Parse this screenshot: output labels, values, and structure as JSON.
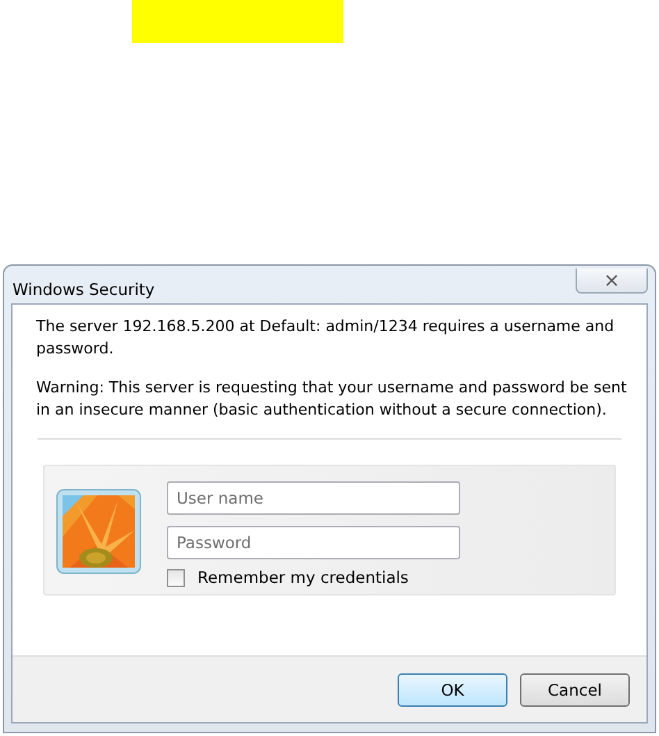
{
  "window": {
    "title": "Windows Security",
    "close": "×"
  },
  "message": "The server 192.168.5.200 at Default: admin/1234 requires a username and password.",
  "warning": "Warning: This server is requesting that your username and password be sent in an insecure manner (basic authentication without a secure connection).",
  "credentials": {
    "username": {
      "placeholder": "User name"
    },
    "password": {
      "placeholder": "Password"
    },
    "remember": {
      "label": "Remember my credentials",
      "checked": false
    }
  },
  "buttons": [
    {
      "label": "OK",
      "default": true
    },
    {
      "label": "Cancel",
      "default": false
    }
  ]
}
